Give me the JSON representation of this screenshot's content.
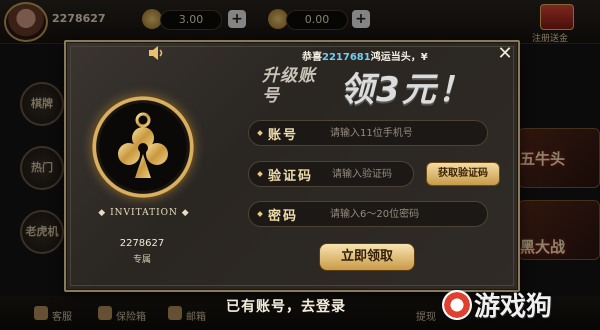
{
  "header": {
    "user_id": "2278627",
    "gold_value": "3.00",
    "diamond_value": "0.00",
    "bonus_label": "注册送金"
  },
  "sidebar": {
    "items": [
      {
        "label": "棋牌"
      },
      {
        "label": "热门"
      },
      {
        "label": "老虎机"
      }
    ]
  },
  "right_panel": {
    "items": [
      {
        "label": "五牛头"
      },
      {
        "label": "黑大战"
      }
    ]
  },
  "bottom_bar": {
    "items": [
      {
        "label": "客服"
      },
      {
        "label": "保险箱"
      },
      {
        "label": "邮箱"
      },
      {
        "label": "提现"
      }
    ]
  },
  "watermark": "游戏狗",
  "modal": {
    "notice_prefix": "恭喜",
    "notice_id": "2217681",
    "notice_suffix": "鸿运当头，¥",
    "headline_small": "升级账号",
    "headline_big": "领3元！",
    "emblem_text": "INVITATION",
    "invitation_id": "2278627",
    "invitation_sub": "专属",
    "fields": {
      "account": {
        "label": "账号",
        "placeholder": "请输入11位手机号"
      },
      "code": {
        "label": "验证码",
        "placeholder": "请输入验证码"
      },
      "password": {
        "label": "密码",
        "placeholder": "请输入6～20位密码"
      }
    },
    "get_code_label": "获取验证码",
    "submit_label": "立即领取",
    "login_link": "已有账号，去登录"
  },
  "colors": {
    "accent_gold": "#d8b060",
    "notice_highlight": "#6fd0f5",
    "button_gold": "#c99a48"
  }
}
